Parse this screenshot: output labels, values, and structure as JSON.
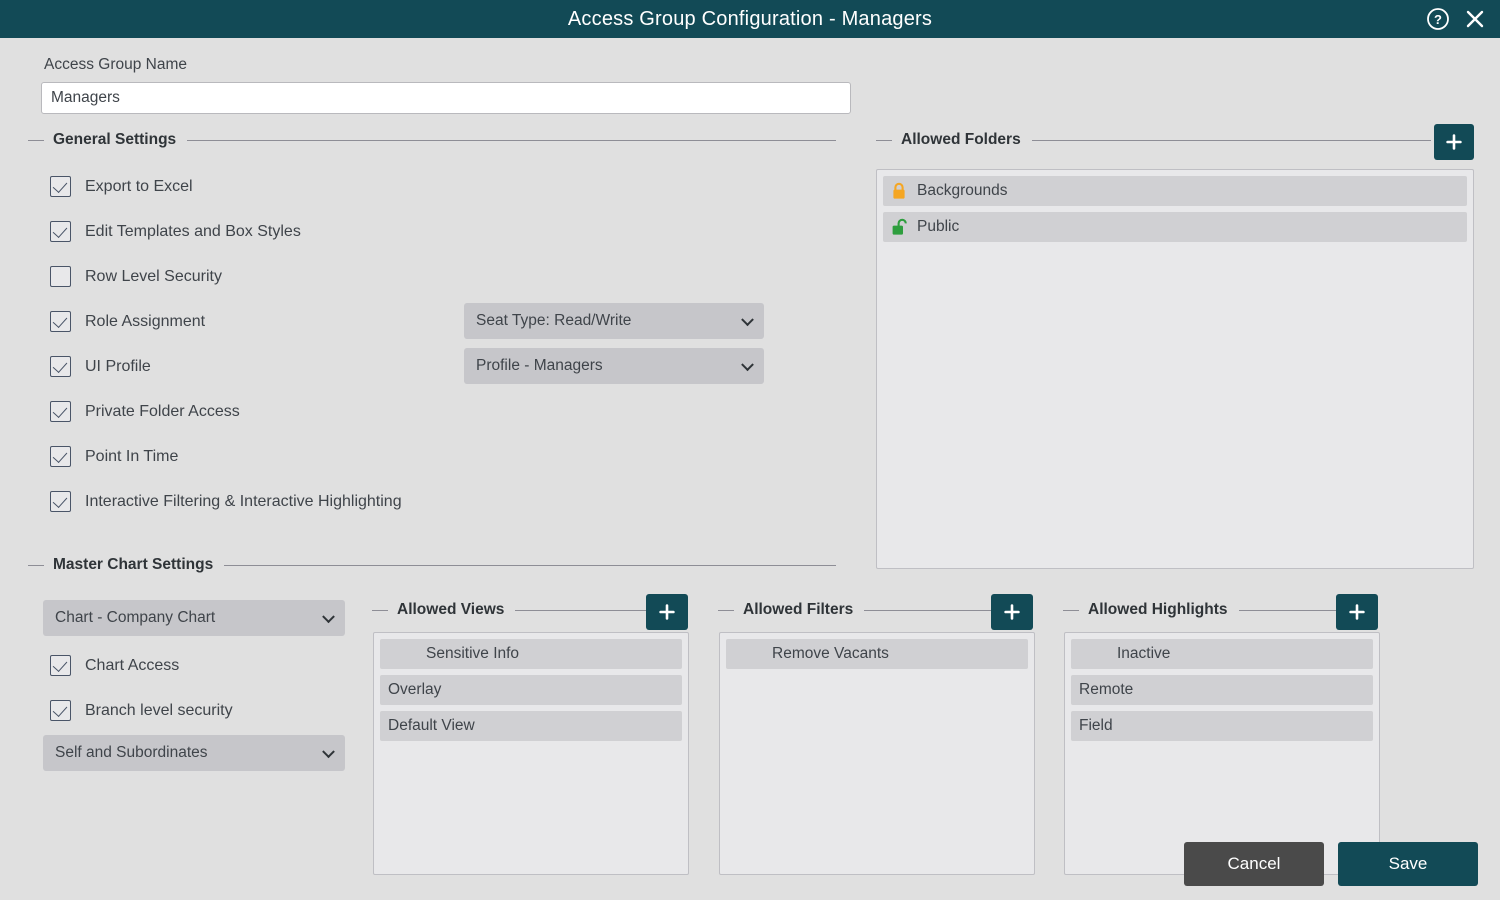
{
  "window": {
    "title": "Access Group Configuration - Managers",
    "help_icon": "help-circle-icon",
    "close_icon": "close-icon"
  },
  "colors": {
    "accent_teal": "#124a56",
    "page_background": "#e0e0e0",
    "panel_background": "#e8e8ea",
    "list_item": "#d0d0d3",
    "select_background": "#c6c6ca",
    "cancel_button": "#4a4a4a",
    "lock_closed": "#f5a623",
    "lock_open": "#2e9e3e"
  },
  "access_group_name": {
    "label": "Access Group Name",
    "value": "Managers",
    "placeholder": "Access Group Name"
  },
  "general_settings": {
    "legend": "General Settings",
    "checkboxes": [
      {
        "label": "Export to Excel",
        "checked": true
      },
      {
        "label": "Edit Templates and Box Styles",
        "checked": true
      },
      {
        "label": "Row Level Security",
        "checked": false
      },
      {
        "label": "Role Assignment",
        "checked": true
      },
      {
        "label": "UI Profile",
        "checked": true
      },
      {
        "label": "Private Folder Access",
        "checked": true
      },
      {
        "label": "Point In Time",
        "checked": true
      },
      {
        "label": "Interactive Filtering & Interactive Highlighting",
        "checked": true
      }
    ],
    "seat_type_select": {
      "value": "Seat Type: Read/Write"
    },
    "profile_select": {
      "value": "Profile - Managers"
    }
  },
  "master_chart_settings": {
    "legend": "Master Chart Settings",
    "chart_select": {
      "value": "Chart - Company Chart"
    },
    "checkboxes": [
      {
        "label": "Chart Access",
        "checked": true
      },
      {
        "label": "Branch level security",
        "checked": true
      }
    ],
    "scope_select": {
      "value": "Self and Subordinates"
    }
  },
  "allowed_folders": {
    "legend": "Allowed Folders",
    "add_button": "+",
    "items": [
      {
        "label": "Backgrounds",
        "lock": "locked"
      },
      {
        "label": "Public",
        "lock": "unlocked"
      }
    ]
  },
  "allowed_views": {
    "legend": "Allowed Views",
    "add_button": "+",
    "items": [
      {
        "label": "Sensitive Info",
        "indent": true
      },
      {
        "label": "Overlay",
        "indent": false
      },
      {
        "label": "Default View",
        "indent": false
      }
    ]
  },
  "allowed_filters": {
    "legend": "Allowed Filters",
    "add_button": "+",
    "items": [
      {
        "label": "Remove Vacants",
        "indent": true
      }
    ]
  },
  "allowed_highlights": {
    "legend": "Allowed Highlights",
    "add_button": "+",
    "items": [
      {
        "label": "Inactive",
        "indent": true
      },
      {
        "label": "Remote",
        "indent": false
      },
      {
        "label": "Field",
        "indent": false
      }
    ]
  },
  "footer": {
    "cancel_label": "Cancel",
    "save_label": "Save"
  }
}
